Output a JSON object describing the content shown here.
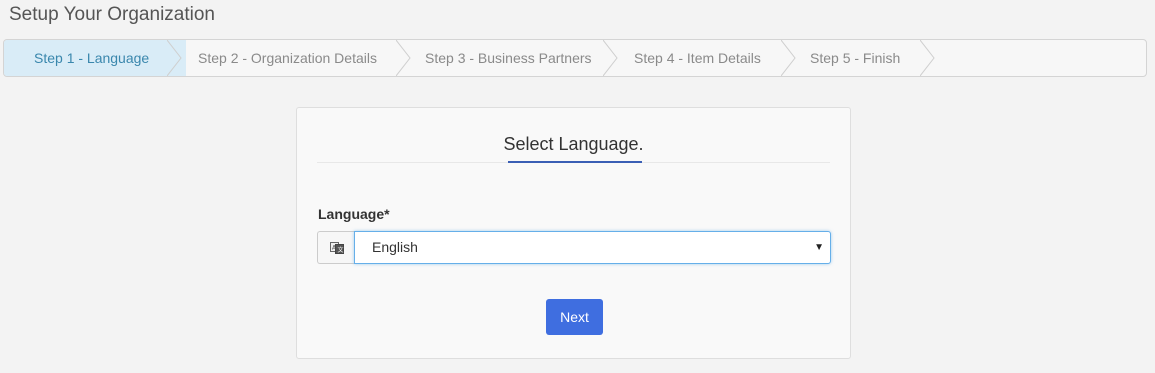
{
  "page": {
    "title": "Setup Your Organization"
  },
  "wizard": {
    "steps": [
      {
        "label": "Step 1 - Language",
        "active": true
      },
      {
        "label": "Step 2 - Organization Details",
        "active": false
      },
      {
        "label": "Step 3 - Business Partners",
        "active": false
      },
      {
        "label": "Step 4 - Item Details",
        "active": false
      },
      {
        "label": "Step 5 - Finish",
        "active": false
      }
    ]
  },
  "card": {
    "title": "Select Language.",
    "language_label": "Language*",
    "language_value": "English",
    "language_icon": "translate-icon",
    "next_label": "Next"
  },
  "colors": {
    "active_step_bg": "#d9ecf7",
    "active_step_text": "#3a87ad",
    "primary_button": "#3f6ee0",
    "title_underline": "#3b5fb5"
  }
}
